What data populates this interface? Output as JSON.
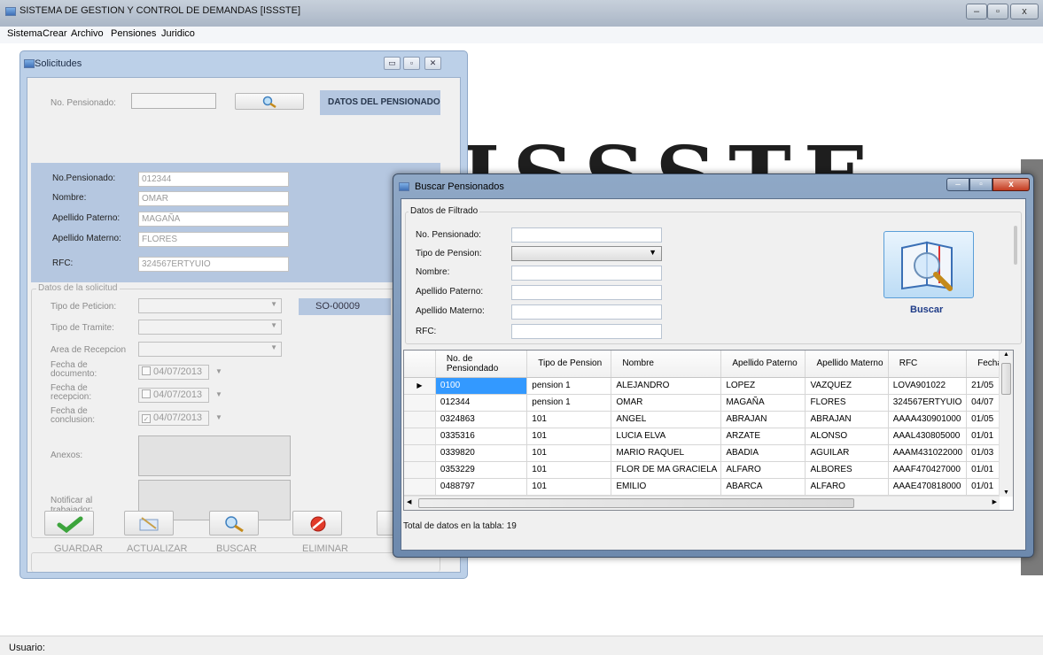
{
  "app": {
    "title": "SISTEMA DE GESTION Y CONTROL DE DEMANDAS [ISSSTE]",
    "status_label": "Usuario:"
  },
  "menu": [
    "Sistema",
    "Crear",
    "Archivo",
    "Pensiones",
    "Juridico"
  ],
  "background_logo": "ISSSTE",
  "solicitudes": {
    "title": "Solicitudes",
    "no_pensionado_label": "No. Pensionado:",
    "datos_header": "DATOS DEL PENSIONADO",
    "fields": [
      {
        "label": "No.Pensionado:",
        "value": "012344"
      },
      {
        "label": "Nombre:",
        "value": "OMAR"
      },
      {
        "label": "Apellido Paterno:",
        "value": "MAGAÑA"
      },
      {
        "label": "Apellido Materno:",
        "value": "FLORES"
      },
      {
        "label": "RFC:",
        "value": "324567ERTYUIO"
      }
    ],
    "solicitud_legend": "Datos de la solicitud",
    "tipo_peticion_label": "Tipo de Peticion:",
    "tipo_tramite_label": "Tipo de Tramite:",
    "area_recepcion_label": "Area de Recepcion",
    "folio": "SO-00009",
    "fecha_documento_label": "Fecha de documento:",
    "fecha_recepcion_label": "Fecha de recepcion:",
    "fecha_conclusion_label": "Fecha de conclusion:",
    "fecha_documento": "04/07/2013",
    "fecha_recepcion": "04/07/2013",
    "fecha_conclusion": "04/07/2013",
    "anexos_label": "Anexos:",
    "notificar_label": "Notificar al trabajador:",
    "actions": {
      "guardar": "GUARDAR",
      "actualizar": "ACTUALIZAR",
      "buscar": "BUSCAR",
      "eliminar": "ELIMINAR"
    }
  },
  "buscar": {
    "title": "Buscar Pensionados",
    "filter_legend": "Datos de Filtrado",
    "labels": {
      "no_pensionado": "No. Pensionado:",
      "tipo_pension": "Tipo de Pension:",
      "nombre": "Nombre:",
      "apellido_paterno": "Apellido Paterno:",
      "apellido_materno": "Apellido Materno:",
      "rfc": "RFC:"
    },
    "search_button": "Buscar",
    "columns": [
      "No. de Pensiondado",
      "Tipo de Pension",
      "Nombre",
      "Apellido Paterno",
      "Apellido Materno",
      "RFC",
      "Fecha"
    ],
    "rows": [
      [
        "0100",
        "pension 1",
        "ALEJANDRO",
        "LOPEZ",
        "VAZQUEZ",
        "LOVA901022",
        "21/05"
      ],
      [
        "012344",
        "pension 1",
        "OMAR",
        "MAGAÑA",
        "FLORES",
        "324567ERTYUIO",
        "04/07"
      ],
      [
        "0324863",
        "101",
        "ANGEL",
        "ABRAJAN",
        "ABRAJAN",
        "AAAA430901000",
        "01/05"
      ],
      [
        "0335316",
        "101",
        "LUCIA ELVA",
        "ARZATE",
        "ALONSO",
        "AAAL430805000",
        "01/01"
      ],
      [
        "0339820",
        "101",
        "MARIO RAQUEL",
        "ABADIA",
        "AGUILAR",
        "AAAM431022000",
        "01/03"
      ],
      [
        "0353229",
        "101",
        "FLOR DE MA GRACIELA",
        "ALFARO",
        "ALBORES",
        "AAAF470427000",
        "01/01"
      ],
      [
        "0488797",
        "101",
        "EMILIO",
        "ABARCA",
        "ALFARO",
        "AAAE470818000",
        "01/01"
      ]
    ],
    "total_label": "Total de datos en la tabla: 19"
  },
  "colors": {
    "accent": "#3399ff",
    "panel": "#b5c7e0",
    "title_bar": "#aab6c6"
  }
}
